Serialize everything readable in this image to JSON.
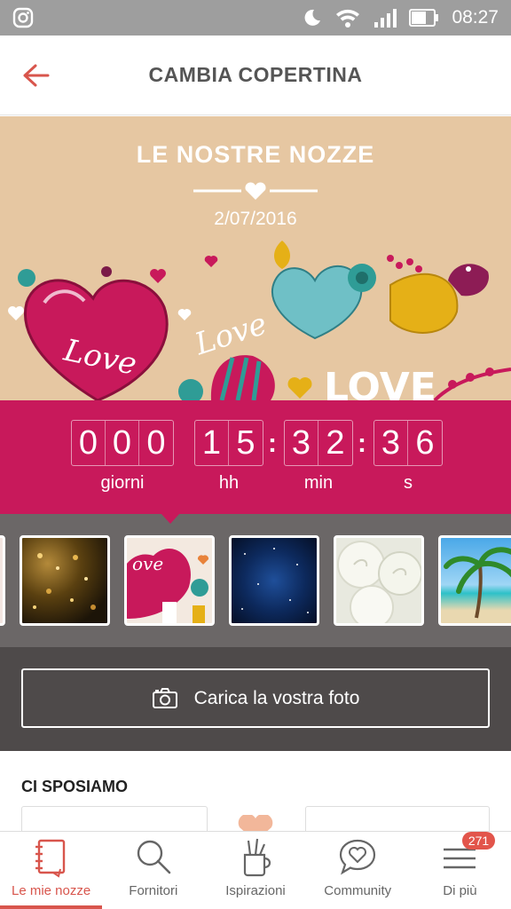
{
  "status_bar": {
    "time": "08:27"
  },
  "app_bar": {
    "title": "CAMBIA COPERTINA"
  },
  "cover": {
    "title": "LE NOSTRE NOZZE",
    "date": "2/07/2016",
    "art_text": [
      "Love",
      "Love",
      "LOVE"
    ]
  },
  "countdown": {
    "days": [
      "0",
      "0",
      "0"
    ],
    "hours": [
      "1",
      "5"
    ],
    "minutes": [
      "3",
      "2"
    ],
    "seconds": [
      "3",
      "6"
    ],
    "labels": {
      "days": "giorni",
      "hours": "hh",
      "minutes": "min",
      "seconds": "s"
    },
    "separator": ":"
  },
  "thumbnails": [
    {
      "name": "partial-left"
    },
    {
      "name": "golden-bokeh"
    },
    {
      "name": "love-doodles",
      "selected": true,
      "text": "ove"
    },
    {
      "name": "blue-starry-sky"
    },
    {
      "name": "white-roses"
    },
    {
      "name": "tropical-beach"
    }
  ],
  "upload": {
    "label": "Carica la vostra foto",
    "icon": "camera-icon"
  },
  "section": {
    "title": "CI SPOSIAMO"
  },
  "bottom_nav": [
    {
      "label": "Le mie nozze",
      "icon": "notebook-icon",
      "active": true
    },
    {
      "label": "Fornitori",
      "icon": "search-icon"
    },
    {
      "label": "Ispirazioni",
      "icon": "brush-cup-icon"
    },
    {
      "label": "Community",
      "icon": "chat-heart-icon"
    },
    {
      "label": "Di più",
      "icon": "menu-icon",
      "badge": "271"
    }
  ],
  "colors": {
    "accent": "#c8195b",
    "nav_active": "#d8554c",
    "cover_bg": "#e6c7a2",
    "thumb_strip": "#6b6767",
    "upload_bg": "#4e4a4a"
  }
}
